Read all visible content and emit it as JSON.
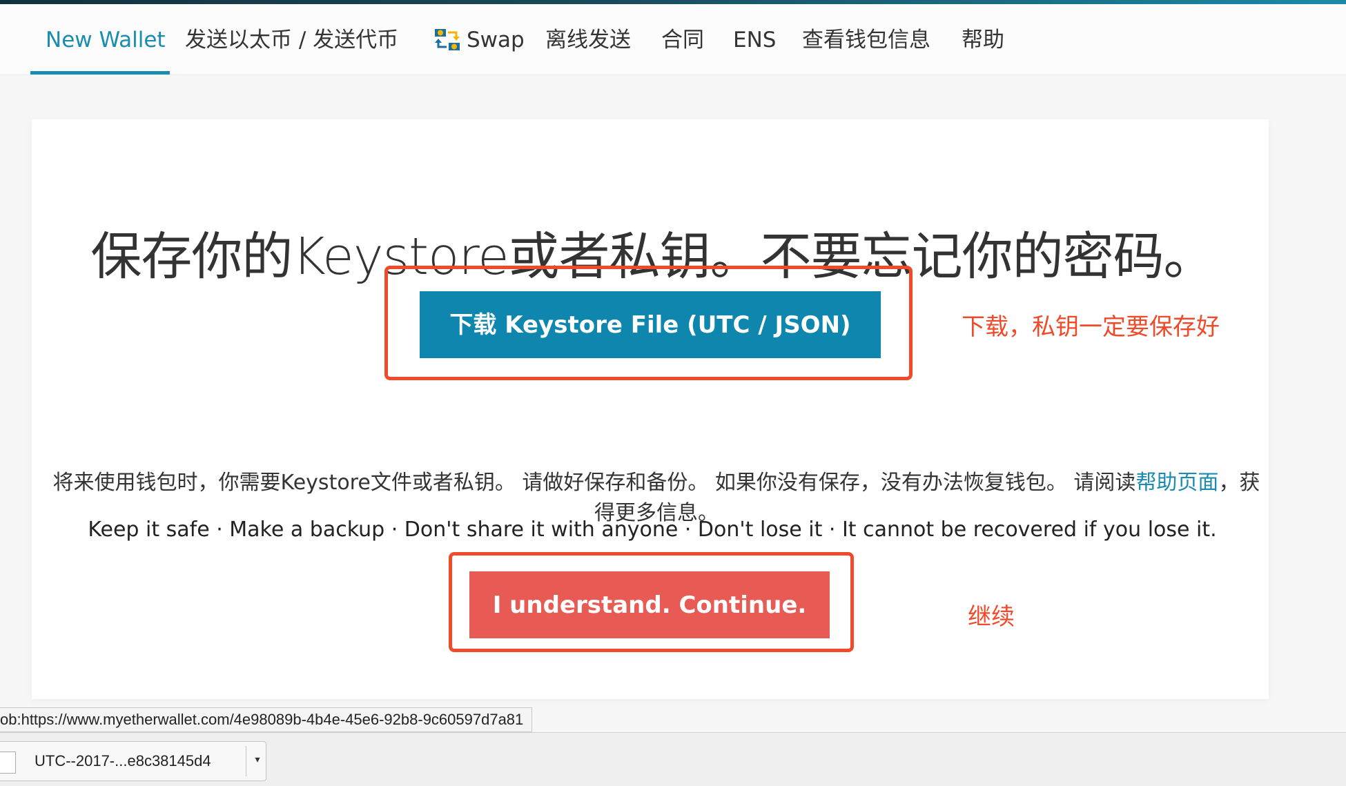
{
  "nav": {
    "items": [
      {
        "label": "New Wallet",
        "active": true
      },
      {
        "label": "发送以太币 / 发送代币"
      },
      {
        "label": "Swap",
        "icon": "swap-icon"
      },
      {
        "label": "离线发送"
      },
      {
        "label": "合同"
      },
      {
        "label": "ENS"
      },
      {
        "label": "查看钱包信息"
      },
      {
        "label": "帮助"
      }
    ]
  },
  "card": {
    "headline": "保存你的Keystore或者私钥。不要忘记你的密码。",
    "download_button": "下载 Keystore File (UTC / JSON)",
    "help_text_before": "将来使用钱包时，你需要Keystore文件或者私钥。 请做好保存和备份。 如果你没有保存，没有办法恢复钱包。 请阅读",
    "help_link": "帮助页面",
    "help_text_after": "，获得更多信息。",
    "warning": "Keep it safe · Make a backup · Don't share it with anyone · Don't lose it · It cannot be recovered if you lose it.",
    "continue_button": "I understand. Continue."
  },
  "annotations": {
    "download_note": "下载，私钥一定要保存好",
    "continue_note": "继续"
  },
  "browser": {
    "status_url": "ob:https://www.myetherwallet.com/4e98089b-4b4e-45e6-92b8-9c60597d7a81",
    "download_file": "UTC--2017-...e8c38145d4"
  },
  "colors": {
    "accent": "#1a8cb0",
    "download_button": "#0e86ad",
    "continue_button": "#e85b54",
    "annotation": "#f04a2a"
  }
}
